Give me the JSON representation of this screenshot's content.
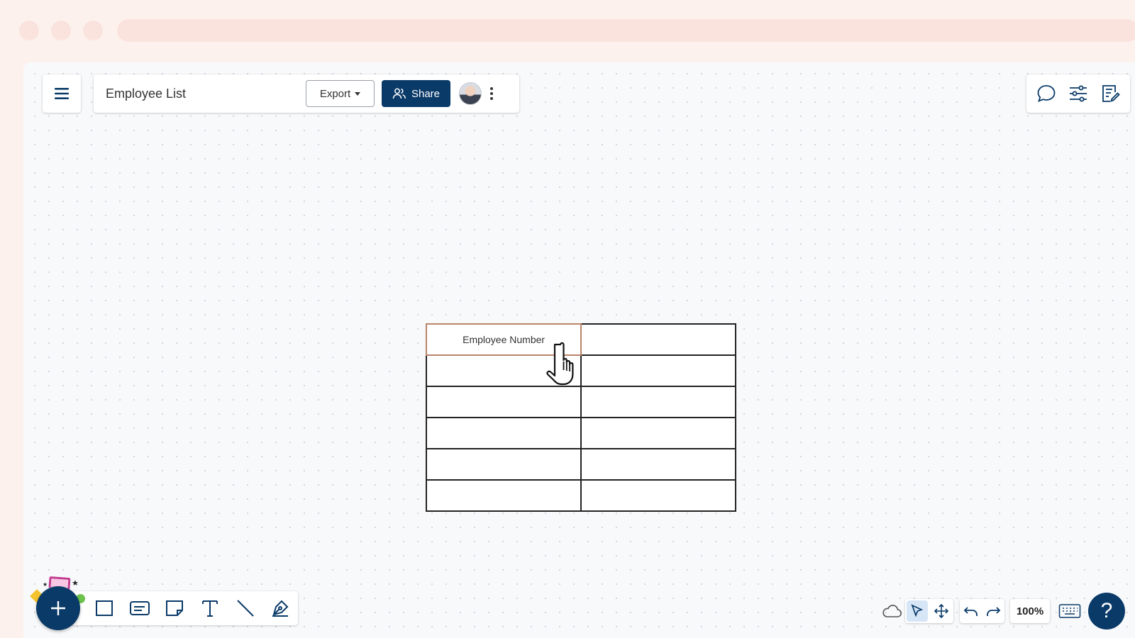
{
  "header": {
    "document_title": "Employee List",
    "export_label": "Export",
    "share_label": "Share"
  },
  "table": {
    "rows": [
      [
        "Employee Number",
        ""
      ],
      [
        "",
        ""
      ],
      [
        "",
        ""
      ],
      [
        "",
        ""
      ],
      [
        "",
        ""
      ],
      [
        "",
        ""
      ]
    ]
  },
  "controls": {
    "zoom": "100%",
    "help_label": "?"
  },
  "colors": {
    "primary": "#0a3a68",
    "selected_cell_border": "#b9846a",
    "canvas_bg": "#f8f9fb"
  },
  "icons": {
    "menu": "hamburger-icon",
    "share": "users-icon",
    "comment": "comment-icon",
    "settings": "sliders-icon",
    "notes": "edit-note-icon",
    "tools": [
      "rectangle-icon",
      "card-icon",
      "sticky-note-icon",
      "text-icon",
      "line-icon",
      "pen-icon"
    ],
    "cloud": "cloud-icon",
    "select": "pointer-icon",
    "pan": "move-icon",
    "undo": "undo-icon",
    "redo": "redo-icon",
    "keyboard": "keyboard-icon"
  }
}
